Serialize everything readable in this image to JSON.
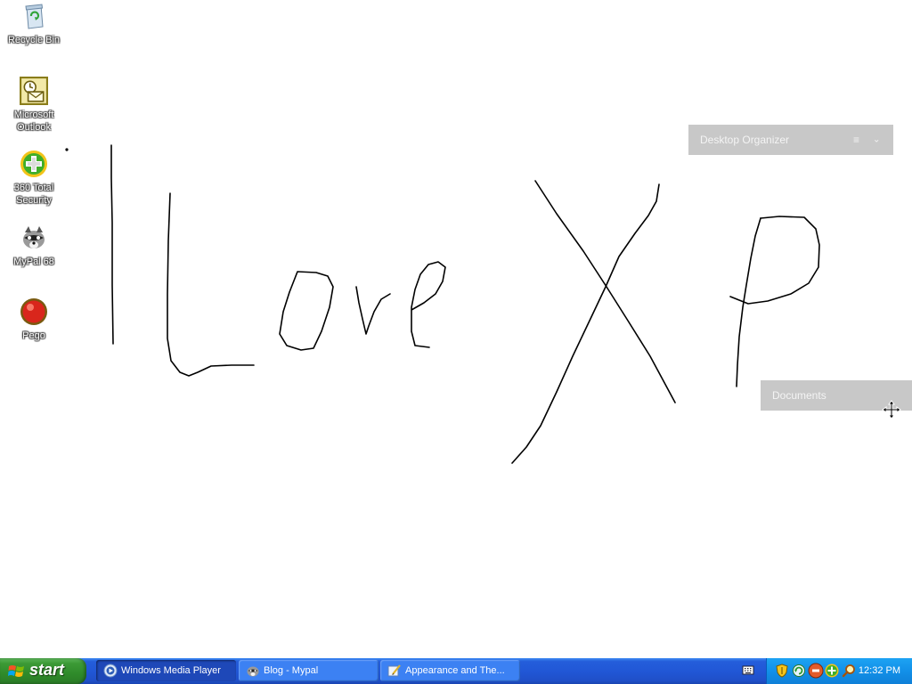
{
  "desktop": {
    "icons": [
      {
        "label_line1": "Recycle Bin",
        "label_line2": "",
        "icon": "recycle-bin-icon"
      },
      {
        "label_line1": "Microsoft",
        "label_line2": "Outlook",
        "icon": "outlook-icon"
      },
      {
        "label_line1": "360 Total",
        "label_line2": "Security",
        "icon": "360-security-icon"
      },
      {
        "label_line1": "MyPal 68",
        "label_line2": "",
        "icon": "mypal-icon"
      },
      {
        "label_line1": "Pego",
        "label_line2": "",
        "icon": "pego-icon"
      }
    ],
    "fences": {
      "organizer_title": "Desktop Organizer",
      "documents_title": "Documents"
    }
  },
  "taskbar": {
    "start_label": "start",
    "tasks": [
      {
        "label": "Windows Media Player",
        "icon": "media-player-icon"
      },
      {
        "label": "Blog - Mypal",
        "icon": "mypal-icon"
      },
      {
        "label": "Appearance and The...",
        "icon": "control-panel-icon"
      }
    ],
    "clock": "12:32 PM"
  },
  "colors": {
    "taskbar_blue": "#245edb",
    "start_green": "#3c9a36",
    "tray_blue": "#1290e8",
    "fence_gray": "#c8c8c8"
  }
}
